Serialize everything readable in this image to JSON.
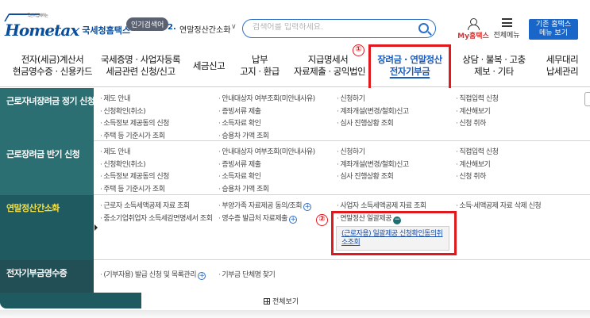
{
  "header": {
    "logo": {
      "text": "Hometax",
      "brand": "국세청홈택스",
      "tagline": "국민이 납세하는"
    },
    "popular": {
      "badge": "인기검색어",
      "rank": "2.",
      "keyword": "연말정산간소화"
    },
    "search": {
      "placeholder": "검색어를 입력하세요."
    },
    "my_hometax": "My홈택스",
    "all_menu": "전체메뉴",
    "old_hometax": [
      "기존 홈택스",
      "메뉴 보기"
    ]
  },
  "gnb": [
    {
      "line1": "전자(세금)계산서",
      "line2": "현금영수증 · 신용카드"
    },
    {
      "line1": "국세증명 · 사업자등록",
      "line2": "세금관련 신청/신고"
    },
    {
      "line1": "세금신고",
      "line2": ""
    },
    {
      "line1": "납부",
      "line2": "고지 · 환급"
    },
    {
      "line1": "지급명세서",
      "line2": "자료제출 · 공익법인"
    },
    {
      "line1": "장려금 · 연말정산",
      "line2": "전자기부금",
      "active": true
    },
    {
      "line1": "상담 · 불복 · 고충",
      "line2": "제보 · 기타"
    },
    {
      "line1": "세무대리",
      "line2": "납세관리"
    }
  ],
  "annotations": {
    "marker1": "①",
    "marker2": "②"
  },
  "mega": {
    "rows": [
      {
        "title": "근로자녀장려금 정기 신청",
        "cols": [
          [
            "제도 안내",
            "신청확인(취소)",
            "소득정보 제공동의 신청",
            "주택 등 기준시가 조회"
          ],
          [
            "안내대상자 여부조회(미안내사유)",
            "증빙서류 제출",
            "소득자료 확인",
            "승용차 가액 조회"
          ],
          [
            "신청하기",
            "계좌개설(변경/철회)신고",
            "심사 진행상황 조회"
          ],
          [
            "직접입력 신청",
            "계산해보기",
            "신청 취하"
          ]
        ]
      },
      {
        "title": "근로장려금 반기 신청",
        "cols": [
          [
            "제도 안내",
            "신청확인(취소)",
            "소득정보 제공동의 신청",
            "주택 등 기준시가 조회"
          ],
          [
            "안내대상자 여부조회(미안내사유)",
            "증빙서류 제출",
            "소득자료 확인",
            "승용차 가액 조회"
          ],
          [
            "신청하기",
            "계좌개설(변경/철회)신고",
            "심사 진행상황 조회"
          ],
          [
            "직접입력 신청",
            "계산해보기",
            "신청 취하"
          ]
        ]
      },
      {
        "title": "연말정산간소화",
        "cols": [
          [
            "근로자 소득세액공제 자료 조회",
            "중소기업취업자 소득세감면명세서 조회"
          ],
          [
            "부양가족 자료제공 동의/조회",
            "영수증 발급처 자료제출"
          ],
          [
            "사업자 소득세액공제 자료 조회",
            "연말정산 일괄제공"
          ],
          [
            "소득·세액공제 자료 삭제 신청"
          ]
        ],
        "sub_item": "(근로자용) 일괄제공 신청확인동의취소조회"
      },
      {
        "title": "전자기부금영수증",
        "cols": [
          [
            "(기부자용) 발급 신청 및 목록관리"
          ],
          [
            "기부금 단체명 찾기"
          ]
        ]
      }
    ]
  },
  "bottom": {
    "view_all": "전체보기"
  },
  "colors": {
    "brand": "#0a4d9c",
    "accent": "#1a5bbf",
    "side_bg": "#25646a",
    "highlight": "#e0191f",
    "active_title": "#f2e04b"
  }
}
